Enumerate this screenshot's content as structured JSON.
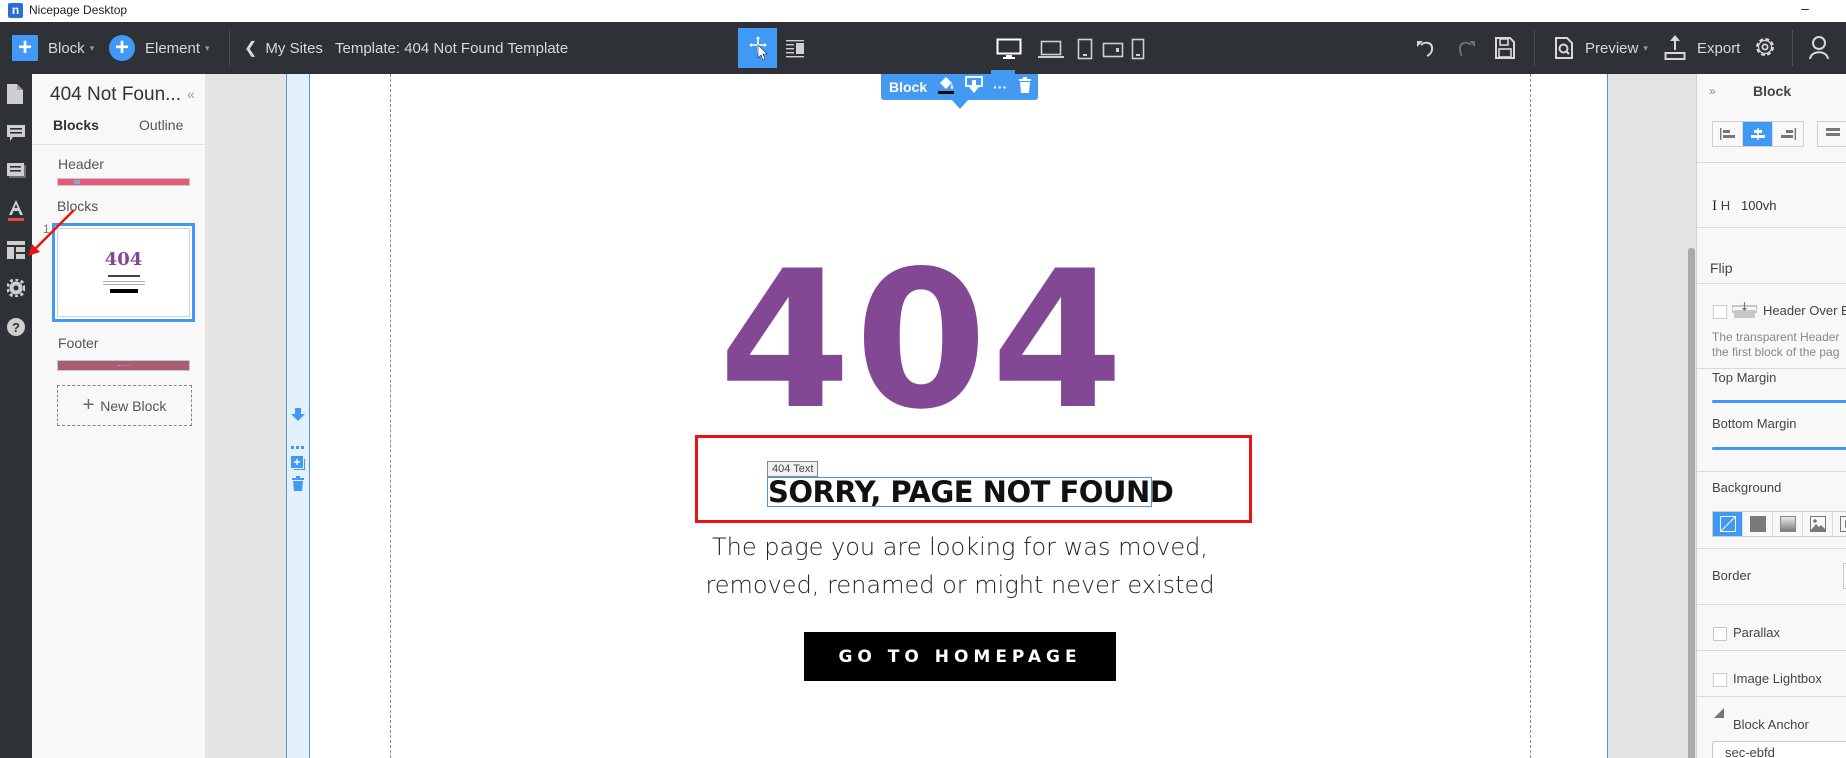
{
  "window": {
    "title": "Nicepage Desktop",
    "logo_letter": "n",
    "minimize_glyph": "–"
  },
  "toolbar": {
    "block_label": "Block",
    "element_label": "Element",
    "back_label": "My Sites",
    "template_label": "Template: 404 Not Found Template",
    "preview_label": "Preview",
    "export_label": "Export",
    "caret": "▾",
    "back_chevron": "❮",
    "plus": "+",
    "devices": [
      "desktop",
      "laptop",
      "tablet",
      "tablet-landscape",
      "phone"
    ],
    "active_device": "desktop",
    "modes": [
      "select-move",
      "text-layout"
    ],
    "active_mode": "select-move"
  },
  "rail": {
    "items": [
      "pages",
      "comments",
      "blocks-list",
      "typography",
      "layout",
      "settings",
      "help"
    ]
  },
  "left_panel": {
    "title": "404 Not Foun...",
    "collapse_glyph": "«",
    "tabs": [
      {
        "label": "Blocks",
        "active": true
      },
      {
        "label": "Outline",
        "active": false
      }
    ],
    "header_label": "Header",
    "blocks_label": "Blocks",
    "block_index": "1",
    "thumb_404": "404",
    "footer_label": "Footer",
    "new_block_label": "New Block",
    "header_color": "#e45b7a",
    "footer_color": "#a85d70"
  },
  "canvas": {
    "block_popup": {
      "label": "Block",
      "tools": [
        "paint-bucket",
        "download-block",
        "more",
        "delete"
      ],
      "more_glyph": "···"
    },
    "side_tools": [
      "arrow-down",
      "more",
      "duplicate",
      "delete"
    ],
    "heading_404": "404",
    "element_tag": "404 Text",
    "subheading": "SORRY, PAGE NOT FOUND",
    "description_line1": "The page you are looking for was moved,",
    "description_line2": "removed, renamed or might never existed",
    "button_label": "GO TO HOMEPAGE",
    "accent_color": "#824894",
    "selection_color": "#ee1111"
  },
  "right_panel": {
    "expand_glyph": "»",
    "title": "Block",
    "align_options": [
      "left",
      "center",
      "right"
    ],
    "align_active": "center",
    "height_label": "H",
    "height_value": "100vh",
    "flip_label": "Flip",
    "header_over_label": "Header Over B",
    "header_over_checked": false,
    "header_over_desc1": "The transparent Header",
    "header_over_desc2": "the first block of the pag",
    "top_margin_label": "Top Margin",
    "bottom_margin_label": "Bottom Margin",
    "background_label": "Background",
    "background_options": [
      "none",
      "color",
      "gradient",
      "image",
      "video"
    ],
    "background_active": "none",
    "border_label": "Border",
    "parallax_label": "Parallax",
    "parallax_checked": false,
    "lightbox_label": "Image Lightbox",
    "lightbox_checked": false,
    "anchor_label": "Block Anchor",
    "anchor_value": "sec-ebfd"
  }
}
